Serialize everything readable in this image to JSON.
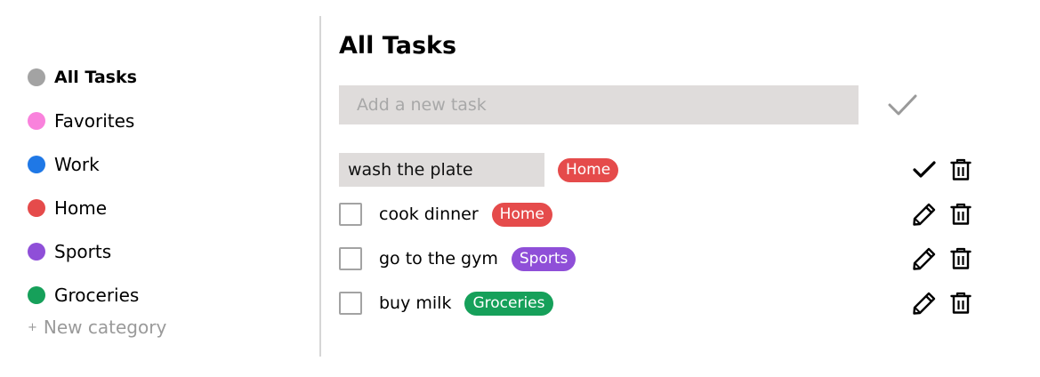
{
  "sidebar": {
    "categories": [
      {
        "label": "All Tasks",
        "color": "#a3a3a3",
        "active": true
      },
      {
        "label": "Favorites",
        "color": "#f982dc"
      },
      {
        "label": "Work",
        "color": "#1f78e6"
      },
      {
        "label": "Home",
        "color": "#e54b4b"
      },
      {
        "label": "Sports",
        "color": "#8f4fd8"
      },
      {
        "label": "Groceries",
        "color": "#16a05a"
      }
    ],
    "new_category_plus": "+",
    "new_category_label": "New category"
  },
  "main": {
    "title": "All Tasks",
    "add_task": {
      "placeholder": "Add a new task",
      "confirm_icon": "check-icon"
    },
    "tasks": [
      {
        "text": "wash the plate",
        "tag": "Home",
        "tag_color": "#e54b4b",
        "editing": true,
        "icons": [
          "check-icon",
          "trash-icon"
        ]
      },
      {
        "text": "cook dinner",
        "tag": "Home",
        "tag_color": "#e54b4b",
        "editing": false,
        "icons": [
          "pencil-icon",
          "trash-icon"
        ]
      },
      {
        "text": "go to the gym",
        "tag": "Sports",
        "tag_color": "#8f4fd8",
        "editing": false,
        "icons": [
          "pencil-icon",
          "trash-icon"
        ]
      },
      {
        "text": "buy milk",
        "tag": "Groceries",
        "tag_color": "#16a05a",
        "editing": false,
        "icons": [
          "pencil-icon",
          "trash-icon"
        ]
      }
    ]
  }
}
